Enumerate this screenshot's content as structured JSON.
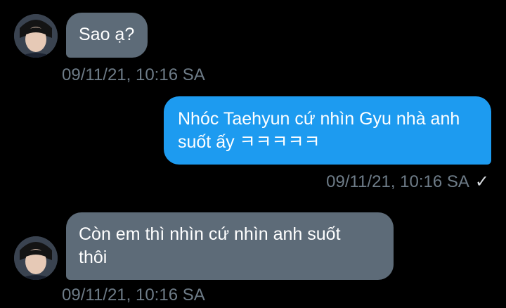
{
  "messages": [
    {
      "direction": "incoming",
      "text": "Sao ạ?",
      "timestamp": "09/11/21, 10:16 SA",
      "avatar_icon": "user-avatar"
    },
    {
      "direction": "outgoing",
      "lines": [
        "Nhóc Taehyun cứ nhìn Gyu nhà anh",
        "suốt ấy ㅋㅋㅋㅋㅋ"
      ],
      "timestamp": "09/11/21, 10:16 SA",
      "status_icon": "check-icon",
      "status_glyph": "✓"
    },
    {
      "direction": "incoming",
      "lines": [
        "Còn em thì nhìn cứ nhìn anh suốt",
        "thôi"
      ],
      "timestamp": "09/11/21, 10:16 SA",
      "avatar_icon": "user-avatar"
    }
  ],
  "colors": {
    "background": "#000000",
    "incoming_bubble": "#5d6b78",
    "outgoing_bubble": "#1d9bf0",
    "timestamp_text": "#6e7c88"
  }
}
